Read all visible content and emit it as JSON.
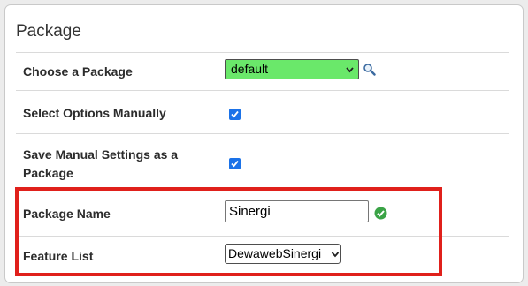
{
  "section": {
    "title": "Package"
  },
  "rows": {
    "choose_package": {
      "label": "Choose a Package",
      "value": "default",
      "highlight_color": "#6ae86a"
    },
    "select_manually": {
      "label": "Select Options Manually",
      "checked": true
    },
    "save_manual": {
      "label_line1": "Save Manual Settings as a",
      "label_line2": "Package",
      "checked": true
    },
    "package_name": {
      "label": "Package Name",
      "value": "Sinergi"
    },
    "feature_list": {
      "label": "Feature List",
      "value": "DewawebSinergi"
    }
  },
  "icons": {
    "search": "magnifier-icon",
    "valid": "check-circle-icon",
    "checkbox": "checkmark-icon"
  },
  "colors": {
    "checkbox": "#1b72e8",
    "valid": "#3aa346",
    "annotation": "#e0201b"
  }
}
